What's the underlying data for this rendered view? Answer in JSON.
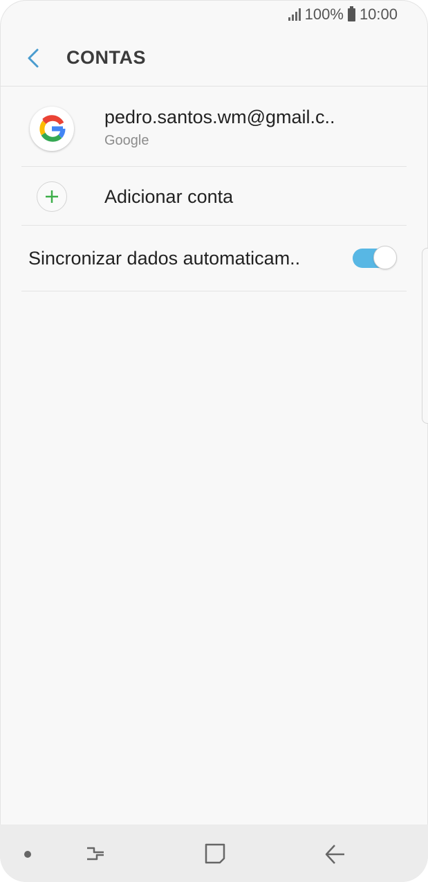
{
  "status_bar": {
    "battery_percent": "100%",
    "time": "10:00"
  },
  "header": {
    "title": "CONTAS",
    "back_icon": "chevron-left-icon"
  },
  "accounts": [
    {
      "email": "pedro.santos.wm@gmail.c..",
      "type": "Google",
      "icon": "google-logo-icon"
    }
  ],
  "add_account": {
    "label": "Adicionar conta",
    "icon": "plus-icon"
  },
  "sync": {
    "label": "Sincronizar dados automaticam..",
    "enabled": true
  },
  "colors": {
    "accent": "#58b7e4",
    "add_green": "#3dae49",
    "back_blue": "#4a9ccf"
  },
  "nav_bar": {
    "icons": [
      "dot-icon",
      "recent-apps-icon",
      "home-icon",
      "back-arrow-icon"
    ]
  }
}
